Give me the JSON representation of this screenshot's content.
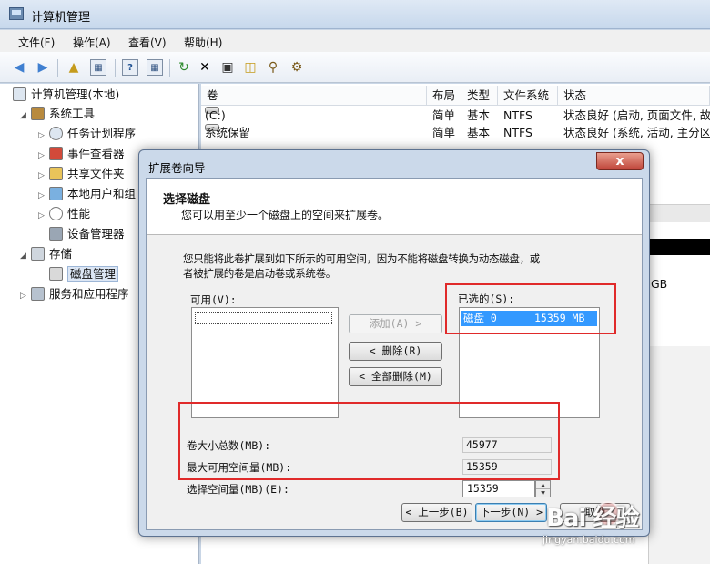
{
  "window": {
    "title": "计算机管理"
  },
  "menubar": {
    "items": [
      "文件(F)",
      "操作(A)",
      "查看(V)",
      "帮助(H)"
    ]
  },
  "toolbar": {
    "icons": [
      "back-arrow-icon",
      "forward-arrow-icon",
      "up-folder-icon",
      "show-hide-tree-icon",
      "help-icon",
      "properties-icon",
      "refresh-icon",
      "delete-icon",
      "new-volume-icon",
      "open-folder-icon",
      "search-icon",
      "disk-settings-icon"
    ]
  },
  "tree": {
    "root": "计算机管理(本地)",
    "system_tools": "系统工具",
    "task_scheduler": "任务计划程序",
    "event_viewer": "事件查看器",
    "shared_folders": "共享文件夹",
    "local_users": "本地用户和组",
    "performance": "性能",
    "device_manager": "设备管理器",
    "storage": "存储",
    "disk_management": "磁盘管理",
    "services_apps": "服务和应用程序"
  },
  "volumes": {
    "columns": [
      "卷",
      "布局",
      "类型",
      "文件系统",
      "状态"
    ],
    "rows": [
      {
        "name": "(C:)",
        "layout": "简单",
        "type": "基本",
        "fs": "NTFS",
        "status": "状态良好 (启动, 页面文件, 故"
      },
      {
        "name": "系统保留",
        "layout": "简单",
        "type": "基本",
        "fs": "NTFS",
        "status": "状态良好 (系统, 活动, 主分区"
      }
    ],
    "partial_gb": "GB"
  },
  "dialog": {
    "title": "扩展卷向导",
    "close": "x",
    "heading": "选择磁盘",
    "subheading": "您可以用至少一个磁盘上的空间来扩展卷。",
    "desc_line1": "您只能将此卷扩展到如下所示的可用空间，因为不能将磁盘转换为动态磁盘，或",
    "desc_line2": "者被扩展的卷是启动卷或系统卷。",
    "available_label": "可用(V):",
    "selected_label": "已选的(S):",
    "selected_item_disk": "磁盘 0",
    "selected_item_size": "15359 MB",
    "add_button": "添加(A) >",
    "remove_button": "< 删除(R)",
    "remove_all_button": "< 全部删除(M)",
    "total_label": "卷大小总数(MB):",
    "total_value": "45977",
    "max_label": "最大可用空间量(MB):",
    "max_value": "15359",
    "select_label": "选择空间量(MB)(E):",
    "select_value": "15359",
    "back_button": "< 上一步(B)",
    "next_button": "下一步(N) >",
    "cancel_button": "取消"
  },
  "watermark": {
    "logo": "Bai 经验",
    "url": "jingyan.baidu.com"
  },
  "colors": {
    "highlight_red": "#e02a2a",
    "selection_blue": "#3399ff"
  }
}
